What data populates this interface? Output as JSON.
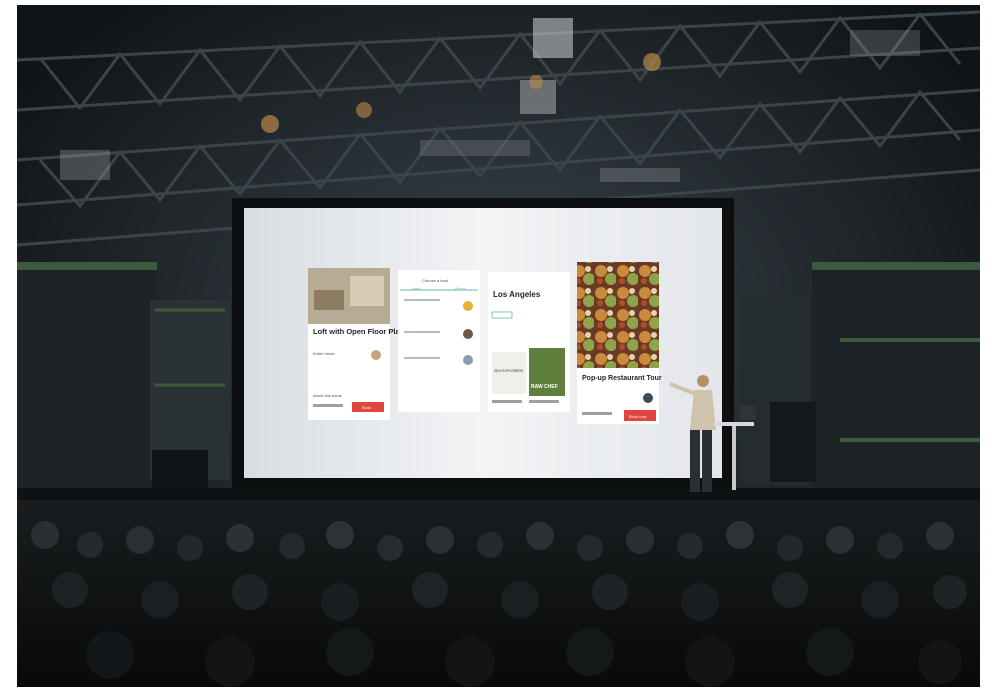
{
  "colors": {
    "frame": "#ffffff",
    "hall": "#15191c",
    "screen": "#e9ecef",
    "accent": "#e0453f",
    "truss": "#2a3136"
  },
  "slides": {
    "card1": {
      "title": "Loft with Open Floor Plan and Kitchen",
      "host_label": "Entire home",
      "about_label": "About this home",
      "button": "Book"
    },
    "card2": {
      "header": "Choose a host",
      "tabs": [
        "Hosts",
        "Places"
      ]
    },
    "card3": {
      "city": "Los Angeles",
      "book1": "ZEN EXPLORERS",
      "book2": "RAW CHEF"
    },
    "card4": {
      "title": "Pop-up Restaurant Tour",
      "button": "Book now"
    }
  }
}
